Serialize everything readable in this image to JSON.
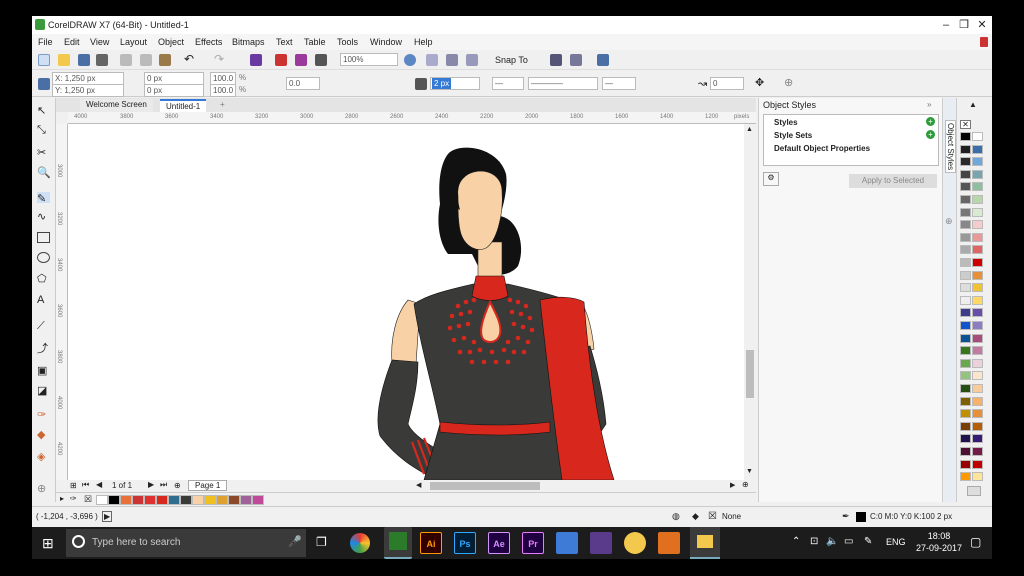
{
  "window": {
    "title": "CorelDRAW X7 (64-Bit) - Untitled-1",
    "minimize": "–",
    "restore": "❐",
    "close": "✕"
  },
  "menu": [
    "File",
    "Edit",
    "View",
    "Layout",
    "Object",
    "Effects",
    "Bitmaps",
    "Text",
    "Table",
    "Tools",
    "Window",
    "Help"
  ],
  "toolbar": {
    "zoom": "100%",
    "snap_to": "Snap To"
  },
  "property_bar": {
    "x": "X: 1,250 px",
    "y": "Y: 1,250 px",
    "w": "0 px",
    "h": "0 px",
    "scale_w": "100.0",
    "scale_h": "100.0",
    "percent": "%",
    "angle": "0.0",
    "outline_width": "2 px",
    "node_value": "0"
  },
  "tabs": {
    "welcome": "Welcome Screen",
    "doc": "Untitled-1",
    "add": "+"
  },
  "ruler": {
    "h_ticks": [
      "4000",
      "3800",
      "3600",
      "3400",
      "3200",
      "3000",
      "2800",
      "2600",
      "2400",
      "2200",
      "2000",
      "1800",
      "1600",
      "1400",
      "1200"
    ],
    "units": "pixels",
    "v_ticks": [
      "3000",
      "3200",
      "3400",
      "3600",
      "3800",
      "4000",
      "4200"
    ]
  },
  "page_nav": {
    "page_count": "1 of 1",
    "page_tab": "Page 1"
  },
  "docker": {
    "title": "Object Styles",
    "tree": [
      "Styles",
      "Style Sets",
      "Default Object Properties"
    ],
    "apply_button": "Apply to Selected",
    "side_tab": "Object Styles"
  },
  "status": {
    "coords": "( -1,204 , -3,696 )",
    "fill": "None",
    "outline": "C:0 M:0 Y:0 K:100  2 px"
  },
  "taskbar": {
    "search_placeholder": "Type here to search",
    "apps": [
      {
        "label": "",
        "color": "#2b7b2b"
      },
      {
        "label": "Ai",
        "color": "#330000"
      },
      {
        "label": "Ps",
        "color": "#001e36"
      },
      {
        "label": "Ae",
        "color": "#1f0040"
      },
      {
        "label": "Pr",
        "color": "#1f0040"
      }
    ],
    "language": "ENG",
    "time": "18:08",
    "date": "27-09-2017"
  },
  "colors": {
    "dress": "#3a3a38",
    "accent_red": "#d8281d",
    "skin": "#f8d2a6",
    "hair": "#111111"
  },
  "doc_palette_colors": [
    "#ffffff",
    "#000000",
    "#e8703a",
    "#cc3333",
    "#e03030",
    "#d8281d",
    "#2f6e8f",
    "#3a3a38",
    "#f8d2a6",
    "#f0c020",
    "#e0a030",
    "#8b4b2b",
    "#a0609a",
    "#c04a9a"
  ],
  "palette_colors": [
    "#000000",
    "#ffffff",
    "#1f1f1f",
    "#3a6ea8",
    "#2a2a2a",
    "#6fa8dc",
    "#444444",
    "#76a5af",
    "#555555",
    "#8fbf9f",
    "#666666",
    "#b6d7a8",
    "#777777",
    "#d9ead3",
    "#888888",
    "#f4cccc",
    "#999999",
    "#ea9999",
    "#aaaaaa",
    "#e06666",
    "#bbbbbb",
    "#cc0000",
    "#cccccc",
    "#e69138",
    "#dddddd",
    "#f1c232",
    "#eeeeee",
    "#ffd966",
    "#3c3c8c",
    "#674ea7",
    "#1155cc",
    "#8e7cc3",
    "#0b5394",
    "#a64d79",
    "#38761d",
    "#c27ba0",
    "#6aa84f",
    "#ead1dc",
    "#93c47d",
    "#fce5cd",
    "#274e13",
    "#f9cb9c",
    "#7f6000",
    "#f6b26b",
    "#bf9000",
    "#e69138",
    "#783f04",
    "#b45f06",
    "#20124d",
    "#351c75",
    "#4c1130",
    "#741b47",
    "#990000",
    "#c00000",
    "#ff9900",
    "#ffe599"
  ]
}
